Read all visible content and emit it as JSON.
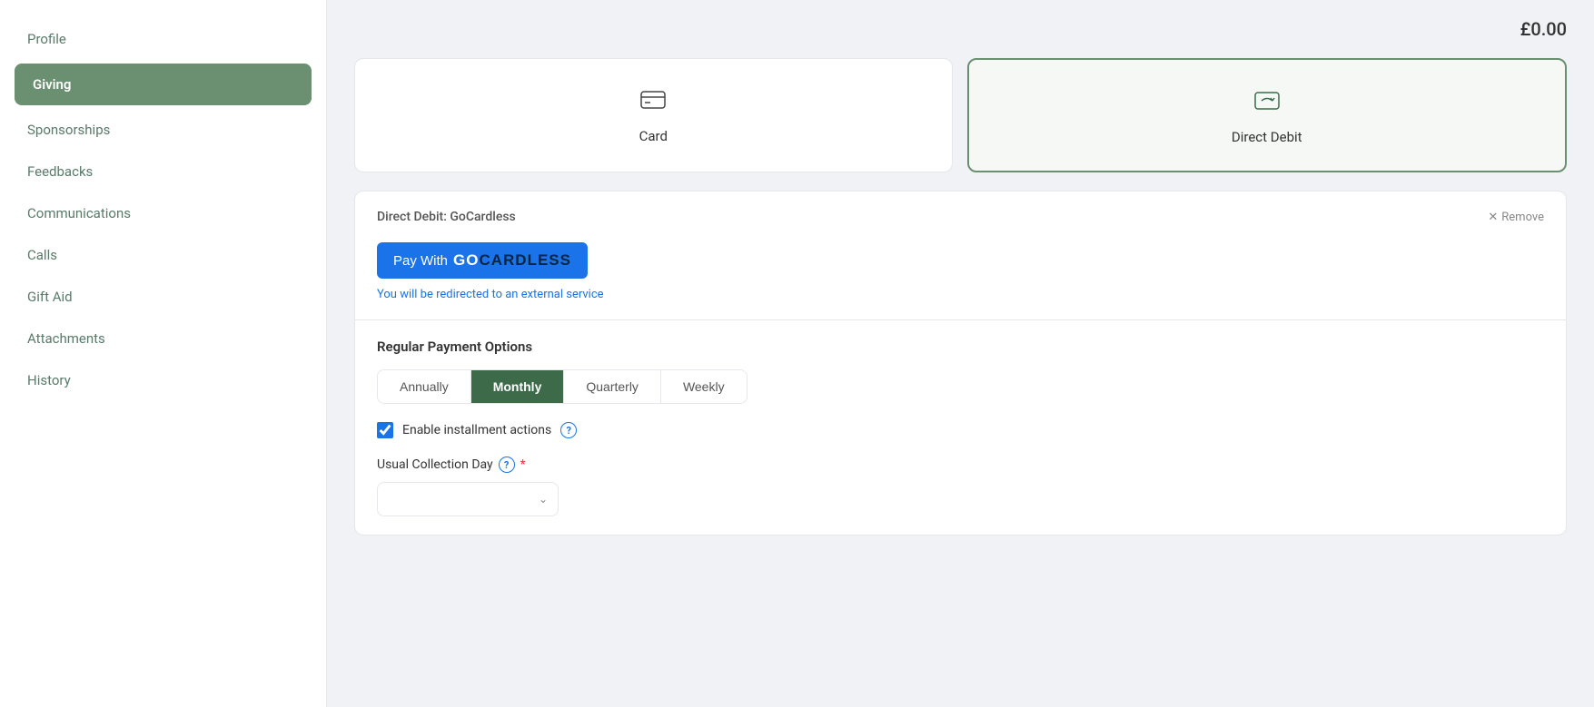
{
  "sidebar": {
    "items": [
      {
        "id": "profile",
        "label": "Profile",
        "active": false
      },
      {
        "id": "giving",
        "label": "Giving",
        "active": true
      },
      {
        "id": "sponsorships",
        "label": "Sponsorships",
        "active": false
      },
      {
        "id": "feedbacks",
        "label": "Feedbacks",
        "active": false
      },
      {
        "id": "communications",
        "label": "Communications",
        "active": false
      },
      {
        "id": "calls",
        "label": "Calls",
        "active": false
      },
      {
        "id": "gift-aid",
        "label": "Gift Aid",
        "active": false
      },
      {
        "id": "attachments",
        "label": "Attachments",
        "active": false
      },
      {
        "id": "history",
        "label": "History",
        "active": false
      }
    ]
  },
  "header": {
    "amount": "£0.00"
  },
  "payment_methods": {
    "card": {
      "label": "Card",
      "selected": false
    },
    "direct_debit": {
      "label": "Direct Debit",
      "selected": true
    }
  },
  "direct_debit_section": {
    "title": "Direct Debit: GoCardless",
    "remove_label": "Remove",
    "gocardless_button": {
      "pay_with": "Pay With",
      "brand_text": "GOCARDLESS"
    },
    "redirect_text_before": "You will be ",
    "redirect_text_link": "redirected",
    "redirect_text_after": " to an external service"
  },
  "regular_payment": {
    "section_title": "Regular Payment Options",
    "frequency_tabs": [
      {
        "id": "annually",
        "label": "Annually",
        "active": false
      },
      {
        "id": "monthly",
        "label": "Monthly",
        "active": true
      },
      {
        "id": "quarterly",
        "label": "Quarterly",
        "active": false
      },
      {
        "id": "weekly",
        "label": "Weekly",
        "active": false
      }
    ],
    "installment_checkbox": {
      "label": "Enable installment actions",
      "checked": true
    },
    "collection_day": {
      "label": "Usual Collection Day",
      "required": true,
      "placeholder": "",
      "options": []
    }
  },
  "icons": {
    "help": "?",
    "remove_x": "✕",
    "chevron_down": "∨"
  }
}
